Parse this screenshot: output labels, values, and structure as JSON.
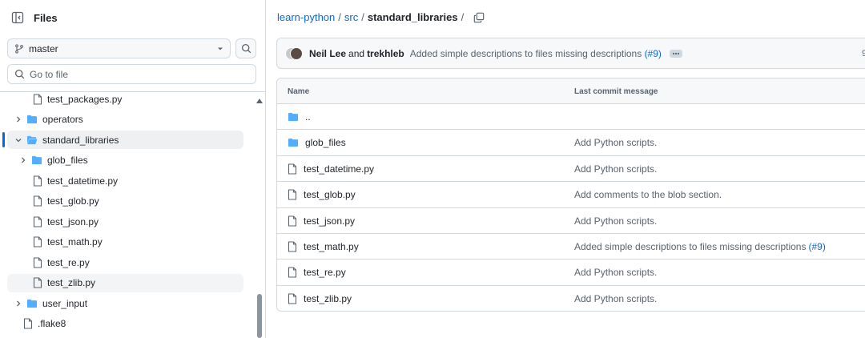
{
  "sidebar": {
    "title": "Files",
    "branch": "master",
    "search_placeholder": "Go to file",
    "tree": [
      {
        "label": "test_packages.py",
        "type": "file",
        "depth": 2
      },
      {
        "label": "operators",
        "type": "folder",
        "depth": 1,
        "expanded": false
      },
      {
        "label": "standard_libraries",
        "type": "folder",
        "depth": 1,
        "expanded": true,
        "selected": true
      },
      {
        "label": "glob_files",
        "type": "folder",
        "depth": 2,
        "expanded": false
      },
      {
        "label": "test_datetime.py",
        "type": "file",
        "depth": 2
      },
      {
        "label": "test_glob.py",
        "type": "file",
        "depth": 2
      },
      {
        "label": "test_json.py",
        "type": "file",
        "depth": 2
      },
      {
        "label": "test_math.py",
        "type": "file",
        "depth": 2
      },
      {
        "label": "test_re.py",
        "type": "file",
        "depth": 2
      },
      {
        "label": "test_zlib.py",
        "type": "file",
        "depth": 2,
        "hover": true
      },
      {
        "label": "user_input",
        "type": "folder",
        "depth": 1,
        "expanded": false
      },
      {
        "label": ".flake8",
        "type": "file",
        "depth": 0
      }
    ]
  },
  "breadcrumb": {
    "repo": "learn-python",
    "dir": "src",
    "current": "standard_libraries",
    "sep1": "/",
    "sep2": "/",
    "sep3": "/"
  },
  "commit": {
    "author1": "Neil Lee",
    "and": "and",
    "author2": "trekhleb",
    "message": "Added simple descriptions to files missing descriptions",
    "pr": "(#9)",
    "count_fragment": "9"
  },
  "table": {
    "col_name": "Name",
    "col_message": "Last commit message",
    "rows": [
      {
        "name": "..",
        "type": "folder",
        "message": "",
        "pr": ""
      },
      {
        "name": "glob_files",
        "type": "folder",
        "message": "Add Python scripts.",
        "pr": ""
      },
      {
        "name": "test_datetime.py",
        "type": "file",
        "message": "Add Python scripts.",
        "pr": ""
      },
      {
        "name": "test_glob.py",
        "type": "file",
        "message": "Add comments to the blob section.",
        "pr": ""
      },
      {
        "name": "test_json.py",
        "type": "file",
        "message": "Add Python scripts.",
        "pr": ""
      },
      {
        "name": "test_math.py",
        "type": "file",
        "message": "Added simple descriptions to files missing descriptions",
        "pr": "(#9)"
      },
      {
        "name": "test_re.py",
        "type": "file",
        "message": "Add Python scripts.",
        "pr": ""
      },
      {
        "name": "test_zlib.py",
        "type": "file",
        "message": "Add Python scripts.",
        "pr": ""
      }
    ]
  },
  "colors": {
    "accent": "#0969da",
    "folder": "#54aeff",
    "muted": "#59636e",
    "border": "#d1d9e0"
  }
}
